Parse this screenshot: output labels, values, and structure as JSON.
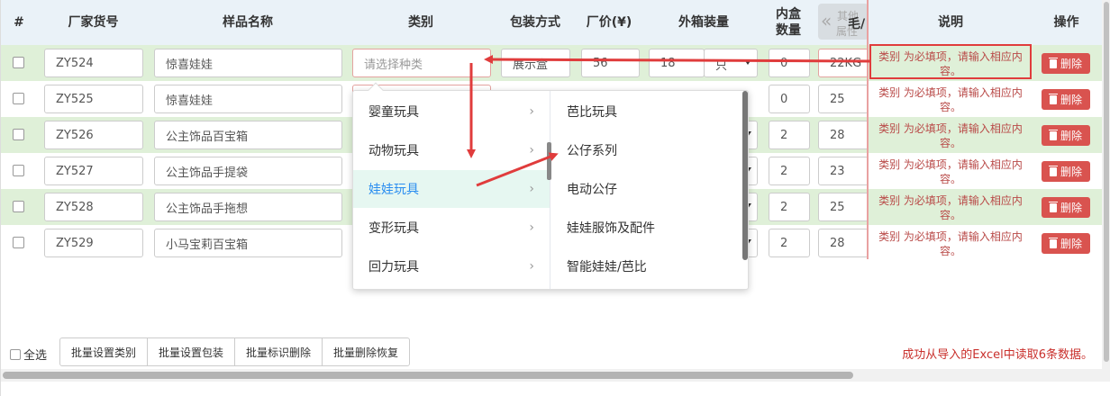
{
  "header": {
    "cols": [
      "#",
      "厂家货号",
      "样品名称",
      "类别",
      "包装方式",
      "厂价(¥)",
      "外箱装量",
      "内盒",
      "数量",
      "说明",
      "操作"
    ],
    "more_label_top": "其他",
    "more_label_bottom": "属性",
    "trailing": "毛/"
  },
  "rows": [
    {
      "code": "ZY524",
      "name": "惊喜娃娃",
      "category": "请选择种类",
      "pack": "展示盒",
      "price": "56",
      "outer": "18",
      "unit": "只",
      "inner": "0",
      "weight": "22KG",
      "desc": "类别 为必填项，请输入相应内容。",
      "delete": "删除"
    },
    {
      "code": "ZY525",
      "name": "惊喜娃娃",
      "inner": "0",
      "weight": "25",
      "desc": "类别 为必填项，请输入相应内容。",
      "delete": "删除"
    },
    {
      "code": "ZY526",
      "name": "公主饰品百宝箱",
      "inner": "2",
      "weight": "28",
      "desc": "类别 为必填项，请输入相应内容。",
      "delete": "删除"
    },
    {
      "code": "ZY527",
      "name": "公主饰品手提袋",
      "inner": "2",
      "weight": "23",
      "desc": "类别 为必填项，请输入相应内容。",
      "delete": "删除"
    },
    {
      "code": "ZY528",
      "name": "公主饰品手拖想",
      "inner": "2",
      "weight": "25",
      "desc": "类别 为必填项，请输入相应内容。",
      "delete": "删除"
    },
    {
      "code": "ZY529",
      "name": "小马宝莉百宝箱",
      "inner": "2",
      "weight": "28",
      "desc": "类别 为必填项，请输入相应内容。",
      "delete": "删除"
    }
  ],
  "dropdown": {
    "left": [
      "婴童玩具",
      "动物玩具",
      "娃娃玩具",
      "变形玩具",
      "回力玩具"
    ],
    "active_index": 2,
    "right": [
      "芭比玩具",
      "公仔系列",
      "电动公仔",
      "娃娃服饰及配件",
      "智能娃娃/芭比"
    ]
  },
  "footer": {
    "select_all": "全选",
    "buttons": [
      "批量设置类别",
      "批量设置包装",
      "批量标识删除",
      "批量删除恢复"
    ],
    "status": "成功从导入的Excel中读取6条数据。"
  },
  "colors": {
    "header_bg": "#eaf2f8",
    "row_green": "#dff0d8",
    "error_red": "#b94a48",
    "delete_red": "#d9534f",
    "arrow_red": "#e03c3c",
    "active_blue": "#2b8ef0"
  },
  "icons": {
    "delete": "trash-icon",
    "chevron_right": "chevron-right-icon",
    "caret": "caret-down-icon",
    "collapse": "double-chevron-left-icon"
  }
}
